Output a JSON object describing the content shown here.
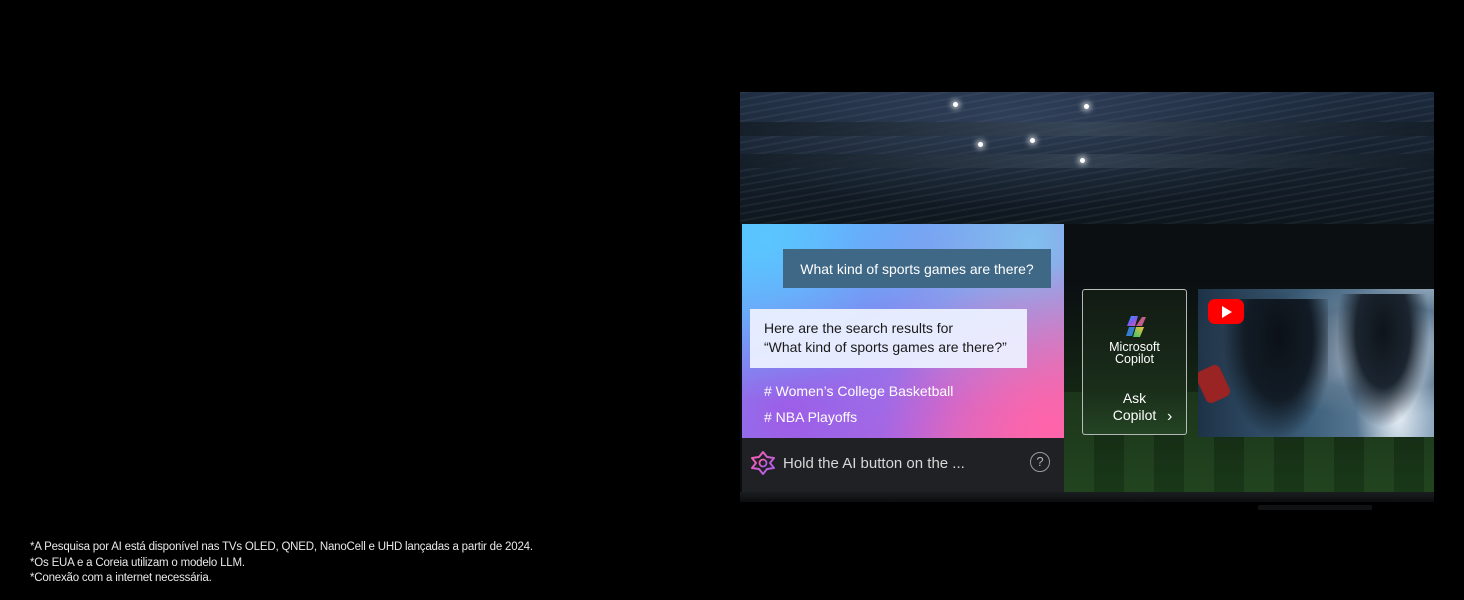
{
  "footnotes": [
    "*A Pesquisa por AI está disponível nas TVs OLED, QNED, NanoCell e UHD lançadas a partir de 2024.",
    "*Os EUA e a Coreia utilizam o modelo LLM.",
    "*Conexão com a internet necessária."
  ],
  "ai_panel": {
    "question": "What kind of sports games are there?",
    "answer_line1": "Here are the search results for",
    "answer_line2": "“What kind of sports games are there?”",
    "tags": [
      "# Women’s College Basketball",
      "# NBA Playoffs"
    ]
  },
  "ai_bar": {
    "hint": "Hold the AI button on the ...",
    "help_icon": "?"
  },
  "copilot_card": {
    "brand_line1": "Microsoft",
    "brand_line2": "Copilot",
    "ask_line1": "Ask",
    "ask_line2": "Copilot",
    "chevron": "›"
  },
  "icons": {
    "youtube": "youtube-icon",
    "copilot": "copilot-logo-icon",
    "ai": "ai-assistant-icon"
  },
  "colors": {
    "question_bubble": "#3f6887",
    "youtube_red": "#ff0000",
    "panel_gradient_start": "#59b8ff",
    "panel_gradient_end": "#f06aa8"
  }
}
